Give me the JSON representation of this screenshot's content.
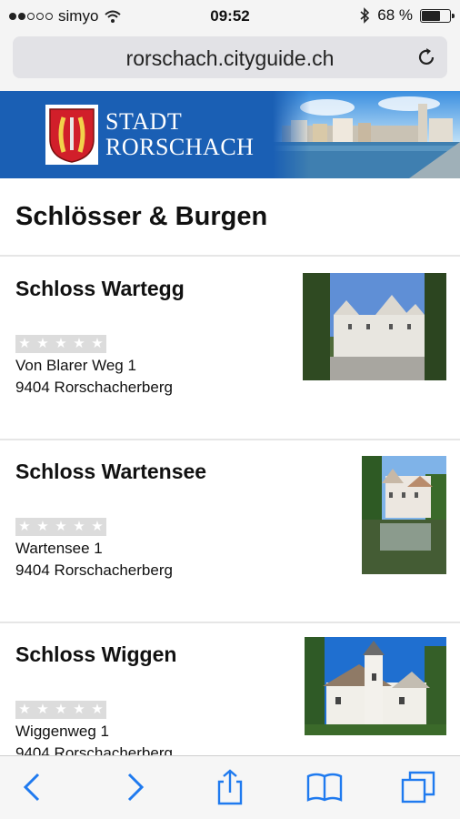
{
  "status_bar": {
    "carrier": "simyo",
    "time": "09:52",
    "battery": "68 %",
    "battery_level": 0.68
  },
  "browser": {
    "url": "rorschach.cityguide.ch"
  },
  "banner": {
    "line1": "STADT",
    "line2": "RORSCHACH"
  },
  "page": {
    "title": "Schlösser & Burgen"
  },
  "items": [
    {
      "name": "Schloss Wartegg",
      "address": "Von Blarer Weg 1",
      "city": "9404 Rorschacherberg",
      "rating": 0
    },
    {
      "name": "Schloss Wartensee",
      "address": "Wartensee 1",
      "city": "9404 Rorschacherberg",
      "rating": 0
    },
    {
      "name": "Schloss Wiggen",
      "address": "Wiggenweg 1",
      "city": "9404 Rorschacherberg",
      "rating": 0
    }
  ],
  "colors": {
    "banner": "#1a5fb4",
    "ios_blue": "#1f7aef"
  }
}
